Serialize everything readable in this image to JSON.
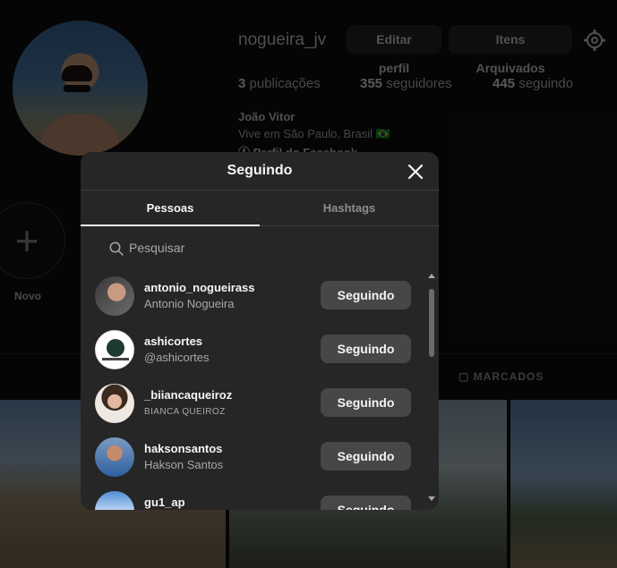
{
  "profile": {
    "username": "nogueira_jv",
    "edit_label": "Editar perfil",
    "archive_label": "Itens Arquivados",
    "stats": {
      "posts_count": "3",
      "posts_label": " publicações",
      "followers_count": "355",
      "followers_label": " seguidores",
      "following_count": "445",
      "following_label": " seguindo"
    },
    "full_name": "João Vitor",
    "bio": "Vive em São Paulo, Brasil 🇧🇷",
    "facebook_link": "Perfil do Facebook",
    "new_highlight_label": "Novo",
    "tagged_tab_label": "MARCADOS"
  },
  "modal": {
    "title": "Seguindo",
    "tabs": [
      {
        "label": "Pessoas",
        "active": true
      },
      {
        "label": "Hashtags",
        "active": false
      }
    ],
    "search_placeholder": "Pesquisar",
    "accounts": [
      {
        "username": "antonio_nogueirass",
        "name": "Antonio Nogueira",
        "button": "Seguindo"
      },
      {
        "username": "ashicortes",
        "name": "@ashicortes",
        "button": "Seguindo"
      },
      {
        "username": "_biiancaqueiroz",
        "name": "BIANCA QUEIROZ",
        "button": "Seguindo"
      },
      {
        "username": "haksonsantos",
        "name": "Hakson Santos",
        "button": "Seguindo"
      },
      {
        "username": "gu1_ap",
        "name": "",
        "button": "Seguindo"
      }
    ]
  }
}
